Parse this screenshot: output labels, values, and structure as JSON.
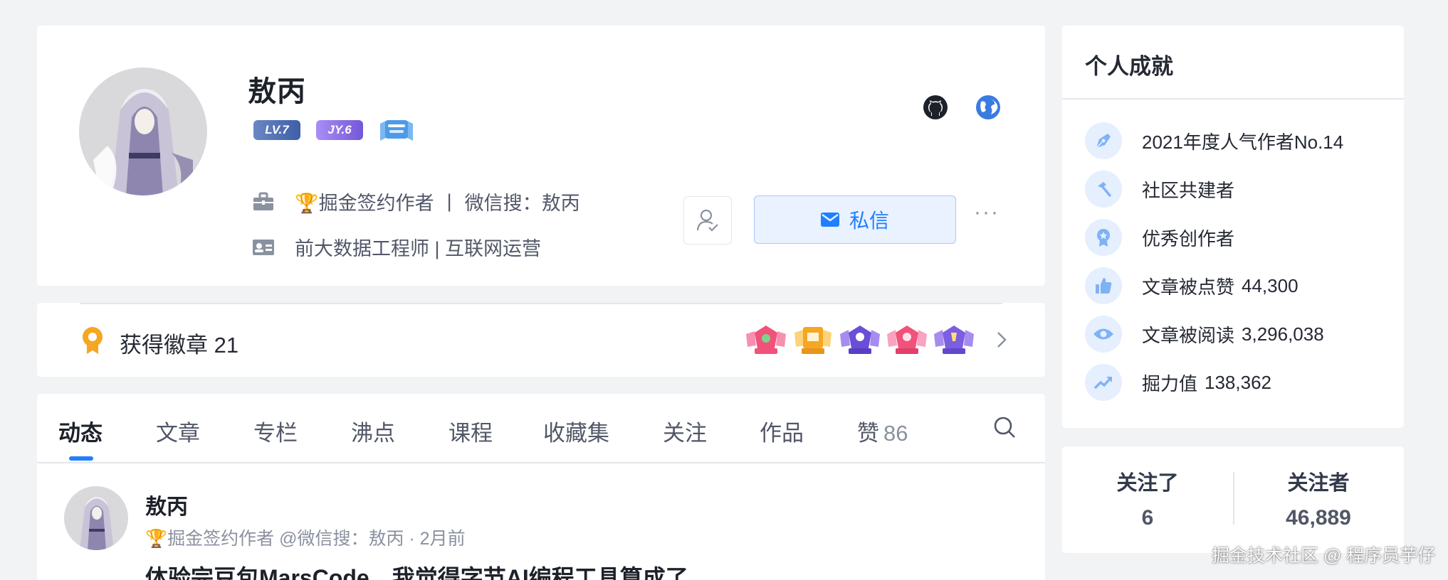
{
  "profile": {
    "name": "敖丙",
    "level_badge": "LV.7",
    "jy_badge": "JY.6",
    "title_line": {
      "signed": "🏆掘金签约作者",
      "divider": "|",
      "wechat": "微信搜：敖丙"
    },
    "job": "前大数据工程师 | 互联网运营",
    "message_button": "私信",
    "more": "···",
    "icons": [
      "github-icon",
      "globe-icon",
      "briefcase-icon",
      "id-card-icon",
      "user-check-icon",
      "mail-icon"
    ]
  },
  "medals": {
    "label": "获得徽章 21",
    "icon": "medal-icon",
    "colors": [
      "#f0527a",
      "#f5a623",
      "#6a4fd6",
      "#f0527a",
      "#7b5fe0"
    ]
  },
  "tabs": [
    {
      "label": "动态",
      "active": true
    },
    {
      "label": "文章"
    },
    {
      "label": "专栏"
    },
    {
      "label": "沸点"
    },
    {
      "label": "课程"
    },
    {
      "label": "收藏集"
    },
    {
      "label": "关注"
    },
    {
      "label": "作品"
    },
    {
      "label": "赞",
      "count": "86"
    }
  ],
  "post": {
    "author": "敖丙",
    "meta": "🏆掘金签约作者 @微信搜：敖丙 · 2月前",
    "title": "体验完豆包MarsCode，我觉得字节AI编程工具算成了"
  },
  "achievements": {
    "title": "个人成就",
    "items": [
      {
        "label": "2021年度人气作者No.14",
        "value": "",
        "icon": "pen-icon"
      },
      {
        "label": "社区共建者",
        "value": "",
        "icon": "hammer-icon"
      },
      {
        "label": "优秀创作者",
        "value": "",
        "icon": "award-icon"
      },
      {
        "label": "文章被点赞",
        "value": "44,300",
        "icon": "thumbs-up-icon"
      },
      {
        "label": "文章被阅读",
        "value": "3,296,038",
        "icon": "eye-icon"
      },
      {
        "label": "掘力值",
        "value": "138,362",
        "icon": "trend-icon"
      }
    ]
  },
  "follow": {
    "following_label": "关注了",
    "following_count": "6",
    "followers_label": "关注者",
    "followers_count": "46,889"
  },
  "watermark": "掘金技术社区 @ 程序员芋仔",
  "colors": {
    "accent": "#1e80ff",
    "background": "#f2f3f5"
  }
}
